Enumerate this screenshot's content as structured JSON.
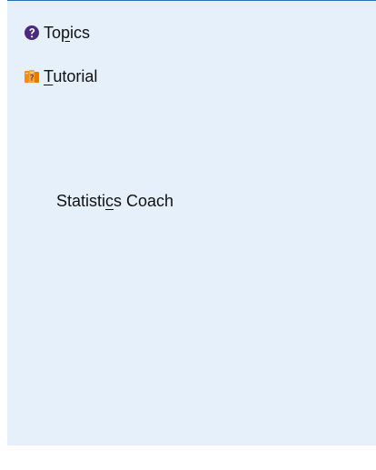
{
  "menu": {
    "topics": {
      "icon": "help-topics-icon",
      "pre": "To",
      "accel": "p",
      "post": "ics"
    },
    "tutorial": {
      "icon": "tutorial-books-icon",
      "pre": "",
      "accel": "T",
      "post": "utorial"
    },
    "coach": {
      "pre": "Statisti",
      "accel": "c",
      "post": "s Coach"
    }
  },
  "colors": {
    "panel_bg": "#e6f0fb",
    "top_border": "#2f6fb6",
    "topics_icon": "#4b2a7d",
    "tutorial_icon": "#f28c1b"
  }
}
